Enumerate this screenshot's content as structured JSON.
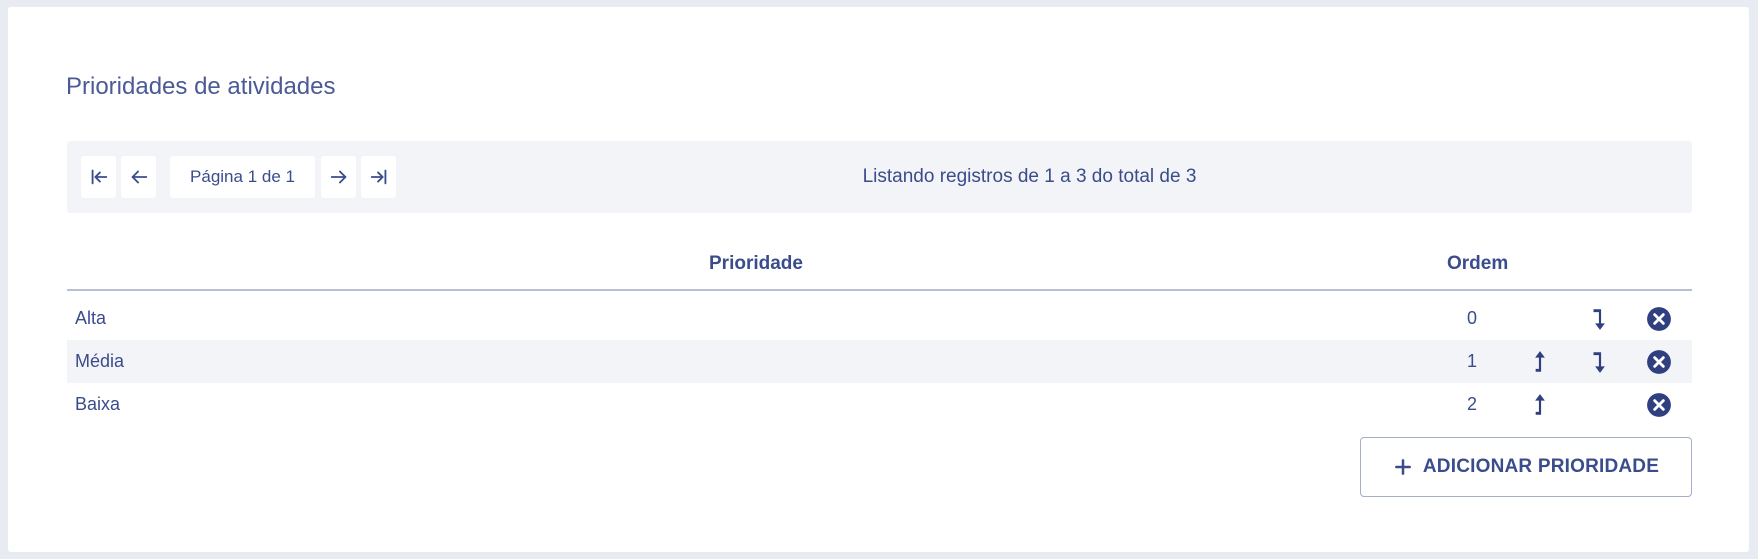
{
  "page": {
    "title": "Prioridades de atividades"
  },
  "pager": {
    "label": "Página 1 de 1",
    "listing": "Listando registros de 1 a 3 do total de 3"
  },
  "table": {
    "headers": {
      "name": "Prioridade",
      "order": "Ordem"
    },
    "rows": [
      {
        "name": "Alta",
        "order": "0"
      },
      {
        "name": "Média",
        "order": "1"
      },
      {
        "name": "Baixa",
        "order": "2"
      }
    ]
  },
  "actions": {
    "add_label": "ADICIONAR PRIORIDADE"
  },
  "colors": {
    "accent": "#3a4c8c",
    "stripe": "#f3f4f7",
    "background": "#e9ebf2"
  },
  "icons": {
    "first": "first-page-icon",
    "prev": "arrow-left-icon",
    "next": "arrow-right-icon",
    "last": "last-page-icon",
    "up": "move-up-icon",
    "down": "move-down-icon",
    "remove": "remove-circle-icon",
    "add": "plus-icon"
  }
}
